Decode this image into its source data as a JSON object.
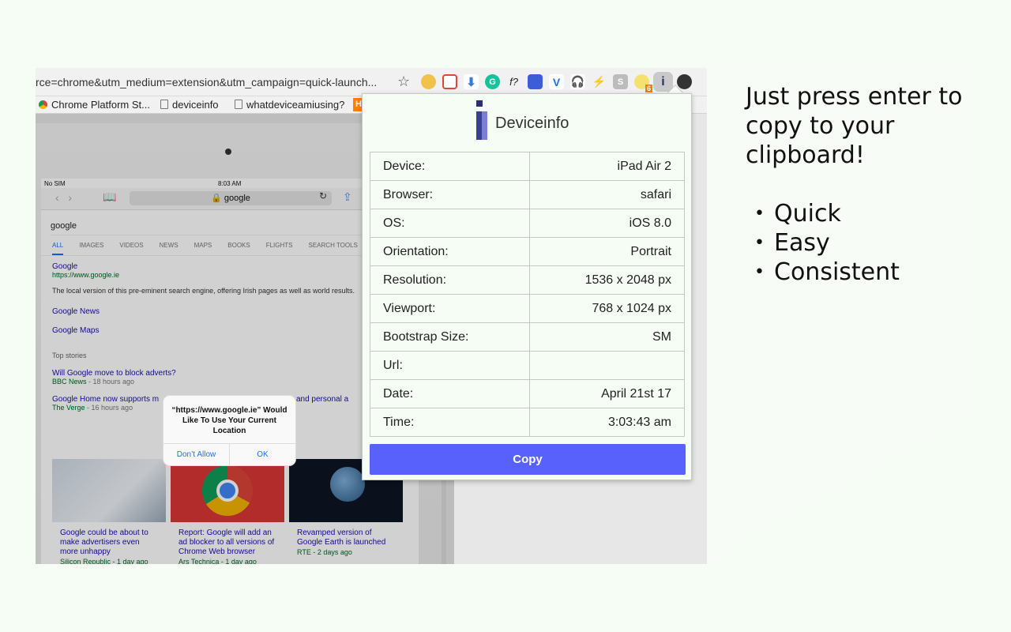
{
  "browser": {
    "url": "rce=chrome&utm_medium=extension&utm_campaign=quick-launch...",
    "bookmarks": [
      "Chrome Platform St...",
      "deviceinfo",
      "whatdeviceamiusing?"
    ],
    "bookmark_h": "H",
    "ext_badge": "6",
    "ext_f_label": "f?"
  },
  "ipad": {
    "carrier": "No SIM",
    "time": "8:03 AM",
    "address": "google",
    "search_query": "google",
    "tabs": [
      "ALL",
      "IMAGES",
      "VIDEOS",
      "NEWS",
      "MAPS",
      "BOOKS",
      "FLIGHTS",
      "SEARCH TOOLS"
    ],
    "result": {
      "title": "Google",
      "url": "https://www.google.ie",
      "desc": "The local version of this pre-eminent search engine, offering Irish pages as well as world results."
    },
    "links": [
      "Google News",
      "Google Maps"
    ],
    "top_stories": "Top stories",
    "stories": [
      {
        "title": "Will Google move to block adverts?",
        "source": "BBC News",
        "time": " - 18 hours ago"
      },
      {
        "title": "Google Home now supports m",
        "title_tail": "work and personal a",
        "source": "The Verge",
        "time": " - 16 hours ago"
      }
    ],
    "cards": [
      {
        "caption": "Google could be about to make advertisers even more unhappy",
        "source": "Silicon Republic - 1 day ago"
      },
      {
        "caption": "Report: Google will add an ad blocker to all versions of Chrome Web browser",
        "source": "Ars Technica - 1 day ago"
      },
      {
        "caption": "Revamped version of Google Earth is launched",
        "source": "RTE - 2 days ago"
      }
    ],
    "dialog": {
      "message": "“https://www.google.ie” Would Like To Use Your Current Location",
      "deny": "Don’t Allow",
      "ok": "OK"
    }
  },
  "popup": {
    "title": "Deviceinfo",
    "rows": [
      {
        "key": "Device:",
        "value": "iPad Air 2"
      },
      {
        "key": "Browser:",
        "value": "safari"
      },
      {
        "key": "OS:",
        "value": "iOS 8.0"
      },
      {
        "key": "Orientation:",
        "value": "Portrait"
      },
      {
        "key": "Resolution:",
        "value": "1536 x 2048 px"
      },
      {
        "key": "Viewport:",
        "value": "768 x 1024 px"
      },
      {
        "key": "Bootstrap Size:",
        "value": "SM"
      },
      {
        "key": "Url:",
        "value": ""
      },
      {
        "key": "Date:",
        "value": "April 21st 17"
      },
      {
        "key": "Time:",
        "value": "3:03:43 am"
      }
    ],
    "copy_label": "Copy",
    "accent_color": "#5861fb"
  },
  "promo": {
    "headline": "Just press enter to copy to your clipboard!",
    "bullets": [
      "Quick",
      "Easy",
      "Consistent"
    ]
  }
}
